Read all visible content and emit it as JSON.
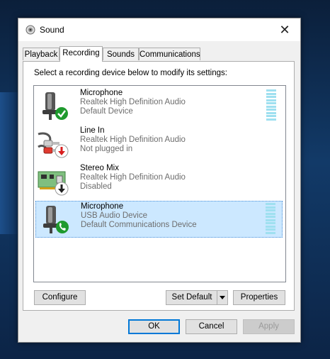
{
  "window": {
    "title": "Sound",
    "close_glyph": "✕"
  },
  "tabs": [
    {
      "label": "Playback"
    },
    {
      "label": "Recording"
    },
    {
      "label": "Sounds"
    },
    {
      "label": "Communications"
    }
  ],
  "active_tab": "Recording",
  "instruction": "Select a recording device below to modify its settings:",
  "devices": [
    {
      "name": "Microphone",
      "driver": "Realtek High Definition Audio",
      "status": "Default Device",
      "icon": "microphone-icon",
      "badge": "default-check-icon",
      "badge_color": "#1f9a2e",
      "selected": false,
      "meter_level": 1.0
    },
    {
      "name": "Line In",
      "driver": "Realtek High Definition Audio",
      "status": "Not plugged in",
      "icon": "line-in-cable-icon",
      "badge": "unplugged-arrow-icon",
      "badge_color": "#d81e1e",
      "selected": false
    },
    {
      "name": "Stereo Mix",
      "driver": "Realtek High Definition Audio",
      "status": "Disabled",
      "icon": "sound-card-icon",
      "badge": "disabled-arrow-icon",
      "badge_color": "#222222",
      "selected": false
    },
    {
      "name": "Microphone",
      "driver": "USB Audio Device",
      "status": "Default Communications Device",
      "icon": "microphone-icon",
      "badge": "communications-phone-icon",
      "badge_color": "#1f9a2e",
      "selected": true,
      "meter_level": 1.0
    }
  ],
  "panel_buttons": {
    "configure": "Configure",
    "set_default": "Set Default",
    "properties": "Properties"
  },
  "dialog_buttons": {
    "ok": "OK",
    "cancel": "Cancel",
    "apply": "Apply",
    "apply_disabled": true
  }
}
